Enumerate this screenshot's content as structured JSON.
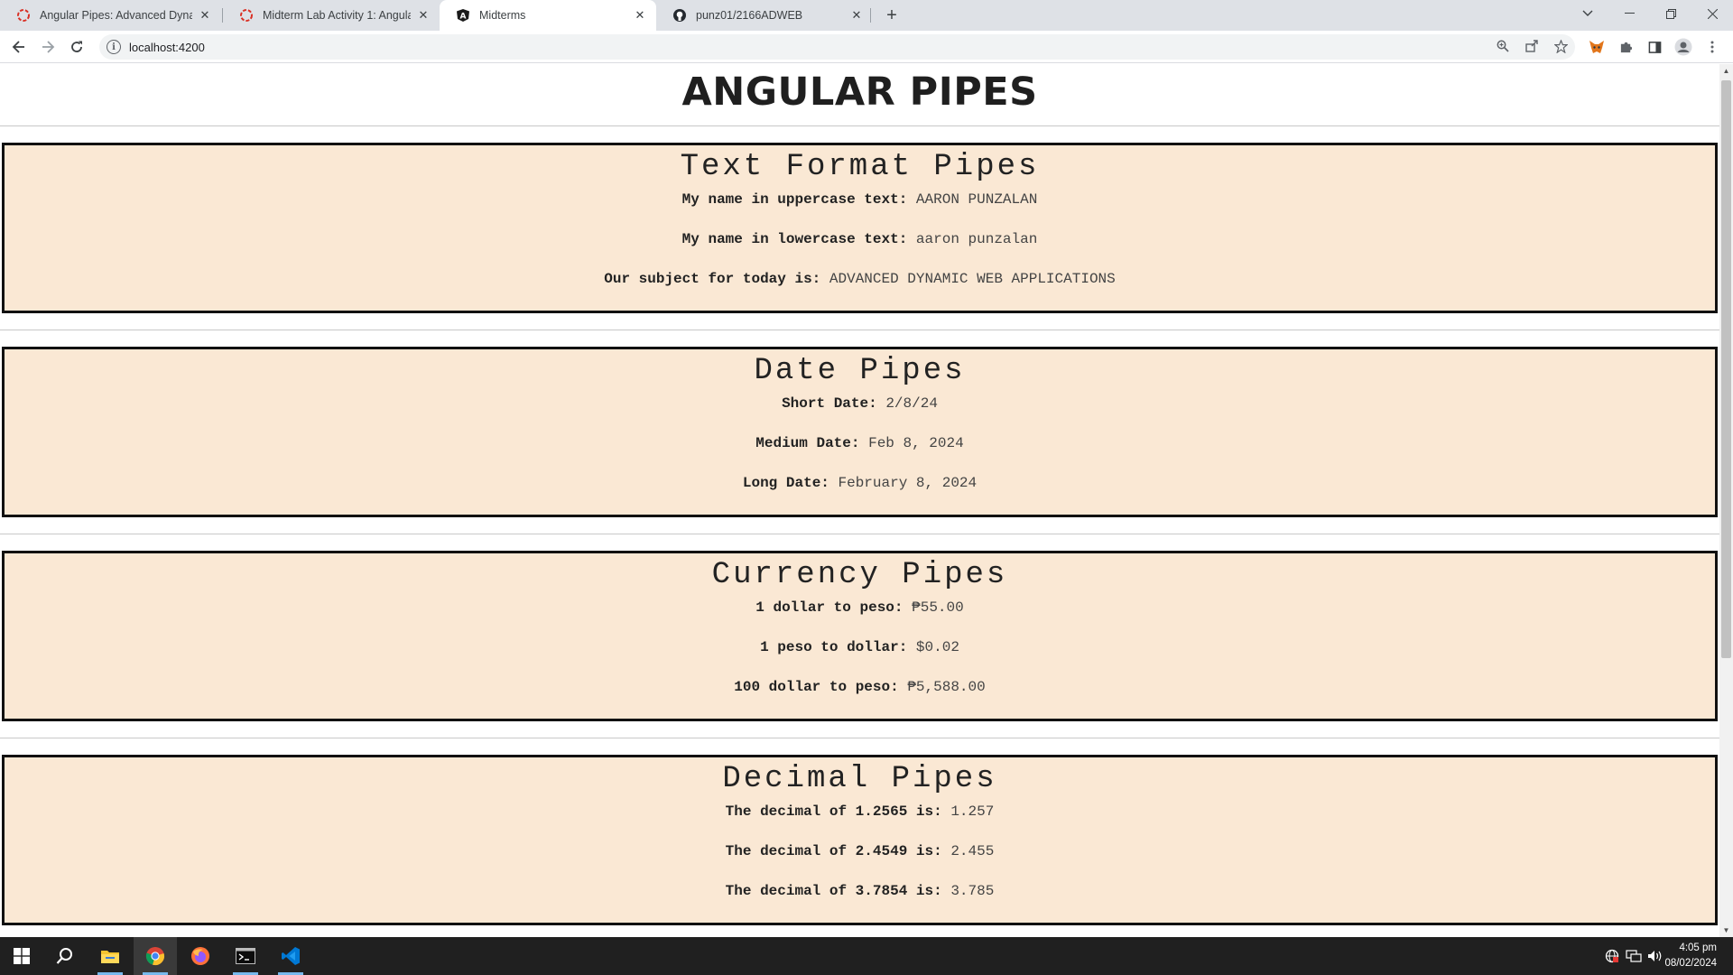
{
  "browser": {
    "tabs": [
      {
        "title": "Angular Pipes: Advanced Dynami",
        "icon": "angular-red-icon",
        "active": false
      },
      {
        "title": "Midterm Lab Activity 1: Angular P",
        "icon": "angular-red-icon",
        "active": false
      },
      {
        "title": "Midterms",
        "icon": "angular-black-icon",
        "active": true
      },
      {
        "title": "punz01/2166ADWEB",
        "icon": "github-icon",
        "active": false
      }
    ],
    "url": "localhost:4200"
  },
  "page": {
    "title": "ANGULAR PIPES",
    "sections": [
      {
        "heading": "Text Format Pipes",
        "rows": [
          {
            "label": "My name in uppercase text:",
            "value": "AARON PUNZALAN"
          },
          {
            "label": "My name in lowercase text:",
            "value": "aaron punzalan"
          },
          {
            "label": "Our subject for today is:",
            "value": "ADVANCED DYNAMIC WEB APPLICATIONS"
          }
        ]
      },
      {
        "heading": "Date Pipes",
        "rows": [
          {
            "label": "Short Date:",
            "value": "2/8/24"
          },
          {
            "label": "Medium Date:",
            "value": "Feb 8, 2024"
          },
          {
            "label": "Long Date:",
            "value": "February 8, 2024"
          }
        ]
      },
      {
        "heading": "Currency Pipes",
        "rows": [
          {
            "label": "1 dollar to peso:",
            "value": "₱55.00"
          },
          {
            "label": "1 peso to dollar:",
            "value": "$0.02"
          },
          {
            "label": "100 dollar to peso:",
            "value": "₱5,588.00"
          }
        ]
      },
      {
        "heading": "Decimal Pipes",
        "rows": [
          {
            "label": "The decimal of 1.2565 is:",
            "value": "1.257"
          },
          {
            "label": "The decimal of 2.4549 is:",
            "value": "2.455"
          },
          {
            "label": "The decimal of 3.7854 is:",
            "value": "3.785"
          }
        ]
      }
    ]
  },
  "taskbar": {
    "time": "4:05 pm",
    "date": "08/02/2024"
  },
  "colors": {
    "section_bg": "#fae8d4",
    "tabstrip_bg": "#dee1e6",
    "taskbar_bg": "#202020"
  }
}
